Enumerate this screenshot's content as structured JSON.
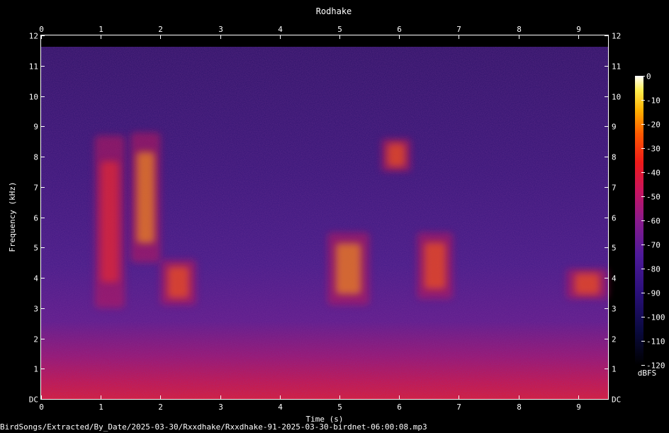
{
  "chart_data": {
    "type": "heatmap",
    "title": "Rodhake",
    "xlabel": "Time (s)",
    "ylabel": "Frequency (kHz)",
    "xlim": [
      0,
      9.5
    ],
    "ylim": [
      0,
      12
    ],
    "x_ticks": [
      0,
      1,
      2,
      3,
      4,
      5,
      6,
      7,
      8,
      9
    ],
    "y_ticks": [
      "DC",
      "1",
      "2",
      "3",
      "4",
      "5",
      "6",
      "7",
      "8",
      "9",
      "10",
      "11",
      "12"
    ],
    "colorbar": {
      "label": "dBFS",
      "ticks": [
        0,
        -10,
        -20,
        -30,
        -40,
        -50,
        -60,
        -70,
        -80,
        -90,
        -100,
        -110,
        -120
      ],
      "range": [
        -120,
        0
      ]
    },
    "energy_regions": [
      {
        "t_start": 0.9,
        "t_end": 1.4,
        "f_low": 3.0,
        "f_high": 8.7,
        "peak_dbfs": -35
      },
      {
        "t_start": 1.5,
        "t_end": 2.0,
        "f_low": 4.5,
        "f_high": 8.8,
        "peak_dbfs": -25
      },
      {
        "t_start": 2.0,
        "t_end": 2.6,
        "f_low": 3.1,
        "f_high": 4.6,
        "peak_dbfs": -30
      },
      {
        "t_start": 4.8,
        "t_end": 5.5,
        "f_low": 3.1,
        "f_high": 5.5,
        "peak_dbfs": -25
      },
      {
        "t_start": 5.7,
        "t_end": 6.2,
        "f_low": 7.5,
        "f_high": 8.6,
        "peak_dbfs": -30
      },
      {
        "t_start": 6.3,
        "t_end": 6.9,
        "f_low": 3.3,
        "f_high": 5.5,
        "peak_dbfs": -30
      },
      {
        "t_start": 8.8,
        "t_end": 9.5,
        "f_low": 3.3,
        "f_high": 4.3,
        "peak_dbfs": -30
      }
    ]
  },
  "footer": {
    "filepath": "BirdSongs/Extracted/By_Date/2025-03-30/Rxxdhake/Rxxdhake-91-2025-03-30-birdnet-06:00:08.mp3"
  },
  "colors": {
    "background": "#000000",
    "text": "#ffffff"
  }
}
